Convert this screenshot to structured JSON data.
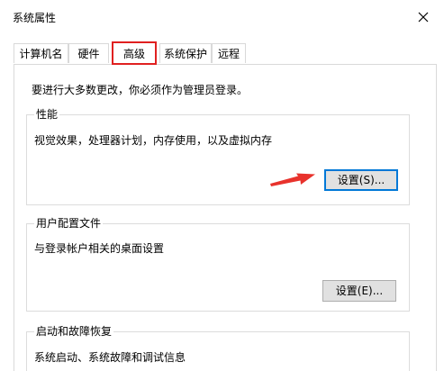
{
  "window": {
    "title": "系统属性"
  },
  "tabs": [
    {
      "label": "计算机名",
      "active": false
    },
    {
      "label": "硬件",
      "active": false
    },
    {
      "label": "高级",
      "active": true
    },
    {
      "label": "系统保护",
      "active": false
    },
    {
      "label": "远程",
      "active": false
    }
  ],
  "content": {
    "admin_note": "要进行大多数更改，你必须作为管理员登录。",
    "performance": {
      "legend": "性能",
      "description": "视觉效果，处理器计划，内存使用，以及虚拟内存",
      "button_label": "设置(S)..."
    },
    "user_profiles": {
      "legend": "用户配置文件",
      "description": "与登录帐户相关的桌面设置",
      "button_label": "设置(E)..."
    },
    "startup_recovery": {
      "legend": "启动和故障恢复",
      "description": "系统启动、系统故障和调试信息"
    }
  },
  "colors": {
    "highlight_box": "#e02020",
    "arrow": "#e8322c",
    "focus_border": "#0078d7"
  },
  "icons": {
    "close": "close-icon",
    "annotation": "red-arrow-icon"
  }
}
